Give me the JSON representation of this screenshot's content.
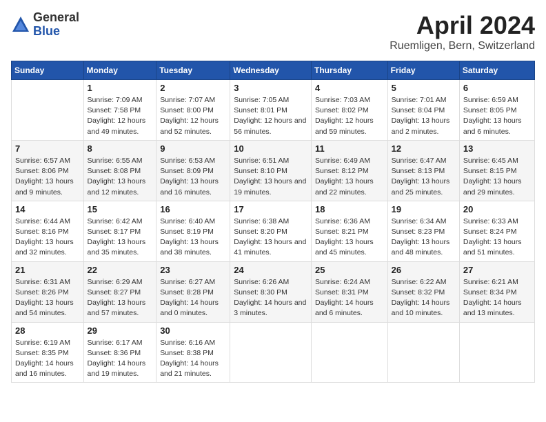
{
  "logo": {
    "general": "General",
    "blue": "Blue"
  },
  "title": "April 2024",
  "subtitle": "Ruemligen, Bern, Switzerland",
  "headers": [
    "Sunday",
    "Monday",
    "Tuesday",
    "Wednesday",
    "Thursday",
    "Friday",
    "Saturday"
  ],
  "weeks": [
    [
      {
        "day": "",
        "sunrise": "",
        "sunset": "",
        "daylight": ""
      },
      {
        "day": "1",
        "sunrise": "Sunrise: 7:09 AM",
        "sunset": "Sunset: 7:58 PM",
        "daylight": "Daylight: 12 hours and 49 minutes."
      },
      {
        "day": "2",
        "sunrise": "Sunrise: 7:07 AM",
        "sunset": "Sunset: 8:00 PM",
        "daylight": "Daylight: 12 hours and 52 minutes."
      },
      {
        "day": "3",
        "sunrise": "Sunrise: 7:05 AM",
        "sunset": "Sunset: 8:01 PM",
        "daylight": "Daylight: 12 hours and 56 minutes."
      },
      {
        "day": "4",
        "sunrise": "Sunrise: 7:03 AM",
        "sunset": "Sunset: 8:02 PM",
        "daylight": "Daylight: 12 hours and 59 minutes."
      },
      {
        "day": "5",
        "sunrise": "Sunrise: 7:01 AM",
        "sunset": "Sunset: 8:04 PM",
        "daylight": "Daylight: 13 hours and 2 minutes."
      },
      {
        "day": "6",
        "sunrise": "Sunrise: 6:59 AM",
        "sunset": "Sunset: 8:05 PM",
        "daylight": "Daylight: 13 hours and 6 minutes."
      }
    ],
    [
      {
        "day": "7",
        "sunrise": "Sunrise: 6:57 AM",
        "sunset": "Sunset: 8:06 PM",
        "daylight": "Daylight: 13 hours and 9 minutes."
      },
      {
        "day": "8",
        "sunrise": "Sunrise: 6:55 AM",
        "sunset": "Sunset: 8:08 PM",
        "daylight": "Daylight: 13 hours and 12 minutes."
      },
      {
        "day": "9",
        "sunrise": "Sunrise: 6:53 AM",
        "sunset": "Sunset: 8:09 PM",
        "daylight": "Daylight: 13 hours and 16 minutes."
      },
      {
        "day": "10",
        "sunrise": "Sunrise: 6:51 AM",
        "sunset": "Sunset: 8:10 PM",
        "daylight": "Daylight: 13 hours and 19 minutes."
      },
      {
        "day": "11",
        "sunrise": "Sunrise: 6:49 AM",
        "sunset": "Sunset: 8:12 PM",
        "daylight": "Daylight: 13 hours and 22 minutes."
      },
      {
        "day": "12",
        "sunrise": "Sunrise: 6:47 AM",
        "sunset": "Sunset: 8:13 PM",
        "daylight": "Daylight: 13 hours and 25 minutes."
      },
      {
        "day": "13",
        "sunrise": "Sunrise: 6:45 AM",
        "sunset": "Sunset: 8:15 PM",
        "daylight": "Daylight: 13 hours and 29 minutes."
      }
    ],
    [
      {
        "day": "14",
        "sunrise": "Sunrise: 6:44 AM",
        "sunset": "Sunset: 8:16 PM",
        "daylight": "Daylight: 13 hours and 32 minutes."
      },
      {
        "day": "15",
        "sunrise": "Sunrise: 6:42 AM",
        "sunset": "Sunset: 8:17 PM",
        "daylight": "Daylight: 13 hours and 35 minutes."
      },
      {
        "day": "16",
        "sunrise": "Sunrise: 6:40 AM",
        "sunset": "Sunset: 8:19 PM",
        "daylight": "Daylight: 13 hours and 38 minutes."
      },
      {
        "day": "17",
        "sunrise": "Sunrise: 6:38 AM",
        "sunset": "Sunset: 8:20 PM",
        "daylight": "Daylight: 13 hours and 41 minutes."
      },
      {
        "day": "18",
        "sunrise": "Sunrise: 6:36 AM",
        "sunset": "Sunset: 8:21 PM",
        "daylight": "Daylight: 13 hours and 45 minutes."
      },
      {
        "day": "19",
        "sunrise": "Sunrise: 6:34 AM",
        "sunset": "Sunset: 8:23 PM",
        "daylight": "Daylight: 13 hours and 48 minutes."
      },
      {
        "day": "20",
        "sunrise": "Sunrise: 6:33 AM",
        "sunset": "Sunset: 8:24 PM",
        "daylight": "Daylight: 13 hours and 51 minutes."
      }
    ],
    [
      {
        "day": "21",
        "sunrise": "Sunrise: 6:31 AM",
        "sunset": "Sunset: 8:26 PM",
        "daylight": "Daylight: 13 hours and 54 minutes."
      },
      {
        "day": "22",
        "sunrise": "Sunrise: 6:29 AM",
        "sunset": "Sunset: 8:27 PM",
        "daylight": "Daylight: 13 hours and 57 minutes."
      },
      {
        "day": "23",
        "sunrise": "Sunrise: 6:27 AM",
        "sunset": "Sunset: 8:28 PM",
        "daylight": "Daylight: 14 hours and 0 minutes."
      },
      {
        "day": "24",
        "sunrise": "Sunrise: 6:26 AM",
        "sunset": "Sunset: 8:30 PM",
        "daylight": "Daylight: 14 hours and 3 minutes."
      },
      {
        "day": "25",
        "sunrise": "Sunrise: 6:24 AM",
        "sunset": "Sunset: 8:31 PM",
        "daylight": "Daylight: 14 hours and 6 minutes."
      },
      {
        "day": "26",
        "sunrise": "Sunrise: 6:22 AM",
        "sunset": "Sunset: 8:32 PM",
        "daylight": "Daylight: 14 hours and 10 minutes."
      },
      {
        "day": "27",
        "sunrise": "Sunrise: 6:21 AM",
        "sunset": "Sunset: 8:34 PM",
        "daylight": "Daylight: 14 hours and 13 minutes."
      }
    ],
    [
      {
        "day": "28",
        "sunrise": "Sunrise: 6:19 AM",
        "sunset": "Sunset: 8:35 PM",
        "daylight": "Daylight: 14 hours and 16 minutes."
      },
      {
        "day": "29",
        "sunrise": "Sunrise: 6:17 AM",
        "sunset": "Sunset: 8:36 PM",
        "daylight": "Daylight: 14 hours and 19 minutes."
      },
      {
        "day": "30",
        "sunrise": "Sunrise: 6:16 AM",
        "sunset": "Sunset: 8:38 PM",
        "daylight": "Daylight: 14 hours and 21 minutes."
      },
      {
        "day": "",
        "sunrise": "",
        "sunset": "",
        "daylight": ""
      },
      {
        "day": "",
        "sunrise": "",
        "sunset": "",
        "daylight": ""
      },
      {
        "day": "",
        "sunrise": "",
        "sunset": "",
        "daylight": ""
      },
      {
        "day": "",
        "sunrise": "",
        "sunset": "",
        "daylight": ""
      }
    ]
  ]
}
